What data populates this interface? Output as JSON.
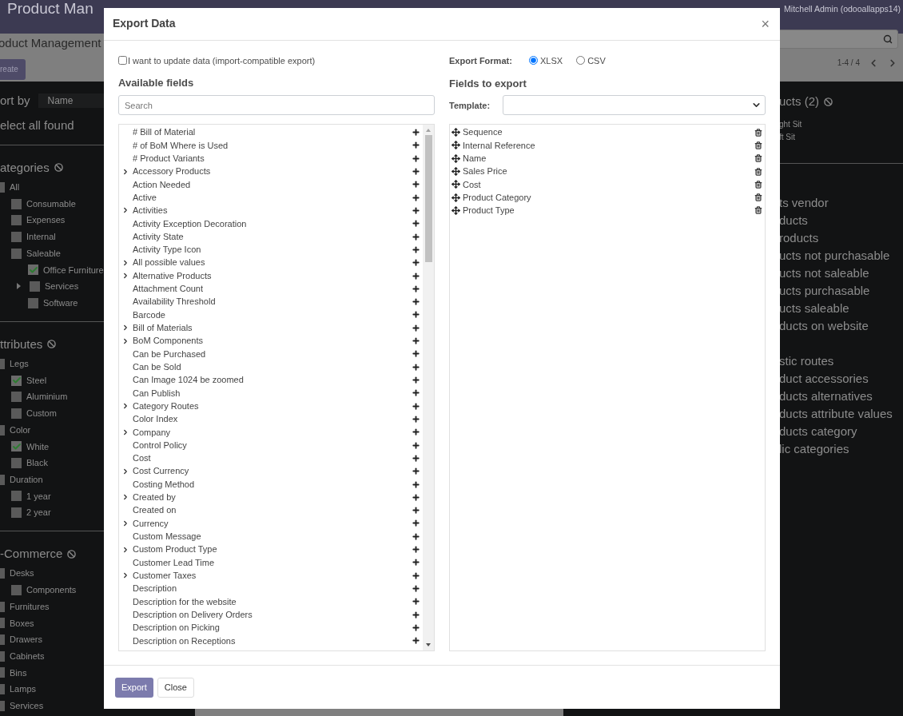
{
  "navbar": {
    "title": "Product Man",
    "user": "Mitchell Admin (odooallapps14)"
  },
  "control_panel": {
    "breadcrumb": "oduct Management",
    "create_button": "reate",
    "pager": "1-4 / 4"
  },
  "sidebar": {
    "sort_label": "ort by",
    "sort_value": "Name",
    "select_all": "elect all found",
    "sections": [
      {
        "title": "ategories",
        "items": [
          {
            "label": "All",
            "checked": false,
            "children": [
              {
                "label": "Consumable",
                "checked": false
              },
              {
                "label": "Expenses",
                "checked": false
              },
              {
                "label": "Internal",
                "checked": false
              },
              {
                "label": "Saleable",
                "checked": false,
                "children": [
                  {
                    "label": "Office Furniture",
                    "checked": true
                  },
                  {
                    "label": "Services",
                    "checked": false,
                    "expandable": true
                  },
                  {
                    "label": "Software",
                    "checked": false
                  }
                ]
              }
            ]
          }
        ]
      },
      {
        "title": "ttributes",
        "items": [
          {
            "label": "Legs",
            "checked": false,
            "children": [
              {
                "label": "Steel",
                "checked": true
              },
              {
                "label": "Aluminium",
                "checked": false
              },
              {
                "label": "Custom",
                "checked": false
              }
            ]
          },
          {
            "label": "Color",
            "checked": false,
            "children": [
              {
                "label": "White",
                "checked": true
              },
              {
                "label": "Black",
                "checked": false
              }
            ]
          },
          {
            "label": "Duration",
            "checked": false,
            "children": [
              {
                "label": "1 year",
                "checked": false
              },
              {
                "label": "2 year",
                "checked": false
              }
            ]
          }
        ]
      },
      {
        "title": "-Commerce",
        "items": [
          {
            "label": "Desks",
            "checked": false,
            "children": [
              {
                "label": "Components",
                "checked": false
              }
            ]
          },
          {
            "label": "Furnitures",
            "checked": false
          },
          {
            "label": "Boxes",
            "checked": false
          },
          {
            "label": "Drawers",
            "checked": false
          },
          {
            "label": "Cabinets",
            "checked": false
          },
          {
            "label": "Bins",
            "checked": false
          },
          {
            "label": "Lamps",
            "checked": false
          },
          {
            "label": "Services",
            "checked": false
          }
        ]
      }
    ]
  },
  "right_panel": {
    "heading": "ucts (2)",
    "products": [
      "ght Sit",
      "ft Sit"
    ],
    "filter_groups": [
      [
        "ts vendor",
        "ducts",
        "roducts",
        "ucts not purchasable",
        "ucts not saleable",
        "ucts purchasable",
        "ucts saleable",
        "ducts on website"
      ],
      [
        "stic routes",
        "duct accessories",
        "ducts alternatives",
        "ducts attribute values",
        "ducts category",
        "lic categories"
      ]
    ]
  },
  "dialog": {
    "title": "Export Data",
    "close": "×",
    "import_compatible": {
      "label": "I want to update data (import-compatible export)",
      "checked": false
    },
    "export_format": {
      "label": "Export Format:",
      "options": [
        {
          "label": "XLSX",
          "selected": true
        },
        {
          "label": "CSV",
          "selected": false
        }
      ]
    },
    "available_fields": {
      "heading": "Available fields",
      "search_placeholder": "Search",
      "fields": [
        {
          "label": "# Bill of Material",
          "kind": "field"
        },
        {
          "label": "# of BoM Where is Used",
          "kind": "field"
        },
        {
          "label": "# Product Variants",
          "kind": "field"
        },
        {
          "label": "Accessory Products",
          "kind": "relation"
        },
        {
          "label": "Action Needed",
          "kind": "field"
        },
        {
          "label": "Active",
          "kind": "field"
        },
        {
          "label": "Activities",
          "kind": "relation"
        },
        {
          "label": "Activity Exception Decoration",
          "kind": "field"
        },
        {
          "label": "Activity State",
          "kind": "field"
        },
        {
          "label": "Activity Type Icon",
          "kind": "field"
        },
        {
          "label": "All possible values",
          "kind": "relation"
        },
        {
          "label": "Alternative Products",
          "kind": "relation"
        },
        {
          "label": "Attachment Count",
          "kind": "field"
        },
        {
          "label": "Availability Threshold",
          "kind": "field"
        },
        {
          "label": "Barcode",
          "kind": "field"
        },
        {
          "label": "Bill of Materials",
          "kind": "relation"
        },
        {
          "label": "BoM Components",
          "kind": "relation"
        },
        {
          "label": "Can be Purchased",
          "kind": "field"
        },
        {
          "label": "Can be Sold",
          "kind": "field"
        },
        {
          "label": "Can Image 1024 be zoomed",
          "kind": "field"
        },
        {
          "label": "Can Publish",
          "kind": "field"
        },
        {
          "label": "Category Routes",
          "kind": "relation"
        },
        {
          "label": "Color Index",
          "kind": "field"
        },
        {
          "label": "Company",
          "kind": "relation"
        },
        {
          "label": "Control Policy",
          "kind": "field"
        },
        {
          "label": "Cost",
          "kind": "field"
        },
        {
          "label": "Cost Currency",
          "kind": "relation"
        },
        {
          "label": "Costing Method",
          "kind": "field"
        },
        {
          "label": "Created by",
          "kind": "relation"
        },
        {
          "label": "Created on",
          "kind": "field"
        },
        {
          "label": "Currency",
          "kind": "relation"
        },
        {
          "label": "Custom Message",
          "kind": "field"
        },
        {
          "label": "Custom Product Type",
          "kind": "relation"
        },
        {
          "label": "Customer Lead Time",
          "kind": "field"
        },
        {
          "label": "Customer Taxes",
          "kind": "relation"
        },
        {
          "label": "Description",
          "kind": "field"
        },
        {
          "label": "Description for the website",
          "kind": "field"
        },
        {
          "label": "Description on Delivery Orders",
          "kind": "field"
        },
        {
          "label": "Description on Picking",
          "kind": "field"
        },
        {
          "label": "Description on Receptions",
          "kind": "field"
        }
      ]
    },
    "fields_to_export": {
      "heading": "Fields to export",
      "template_label": "Template:",
      "fields": [
        "Sequence",
        "Internal Reference",
        "Name",
        "Sales Price",
        "Cost",
        "Product Category",
        "Product Type"
      ]
    },
    "buttons": [
      {
        "label": "Export",
        "kind": "primary"
      },
      {
        "label": "Close",
        "kind": "secondary"
      }
    ]
  }
}
